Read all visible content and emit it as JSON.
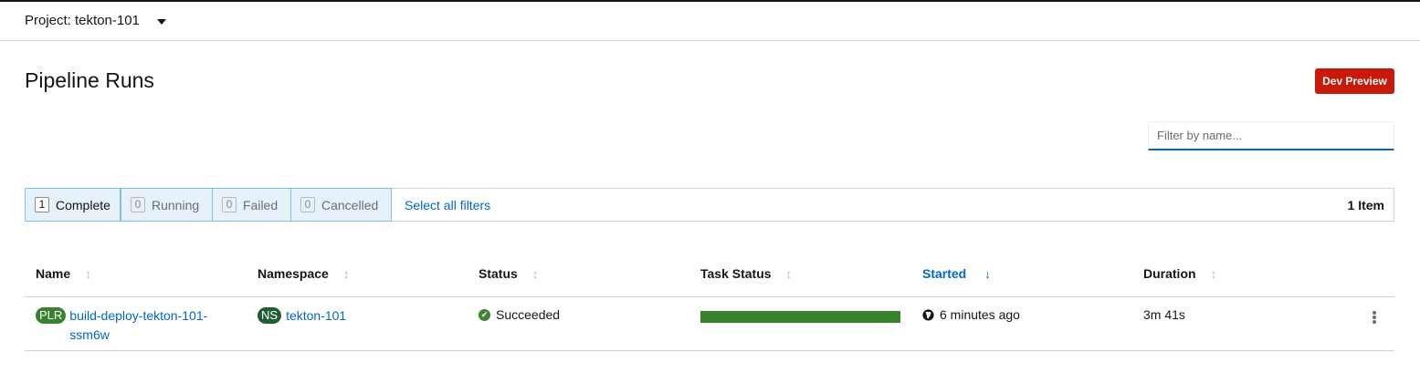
{
  "project": {
    "label": "Project: tekton-101"
  },
  "page": {
    "title": "Pipeline Runs",
    "dev_preview": "Dev Preview"
  },
  "filter": {
    "placeholder": "Filter by name..."
  },
  "row_filters": [
    {
      "count": "1",
      "label": "Complete",
      "active": true
    },
    {
      "count": "0",
      "label": "Running",
      "active": false
    },
    {
      "count": "0",
      "label": "Failed",
      "active": false
    },
    {
      "count": "0",
      "label": "Cancelled",
      "active": false
    }
  ],
  "select_all": "Select all filters",
  "item_count": "1 Item",
  "columns": [
    "Name",
    "Namespace",
    "Status",
    "Task Status",
    "Started",
    "Duration"
  ],
  "sorted_column": "Started",
  "rows": [
    {
      "name_badge": "PLR",
      "name": "build-deploy-tekton-101-ssm6w",
      "ns_badge": "NS",
      "namespace": "tekton-101",
      "status": "Succeeded",
      "task_status_fraction": 1.0,
      "started": "6 minutes ago",
      "duration": "3m 41s"
    }
  ],
  "colors": {
    "accent": "#0066cc",
    "dev_preview": "#c9190b",
    "success": "#3e8635",
    "badge_plr": "#38812f",
    "badge_ns": "#1f5e35"
  },
  "icons": [
    "caret-down-icon",
    "sort-icon",
    "sort-down-icon",
    "check-circle-icon",
    "globe-icon",
    "kebab-icon"
  ]
}
